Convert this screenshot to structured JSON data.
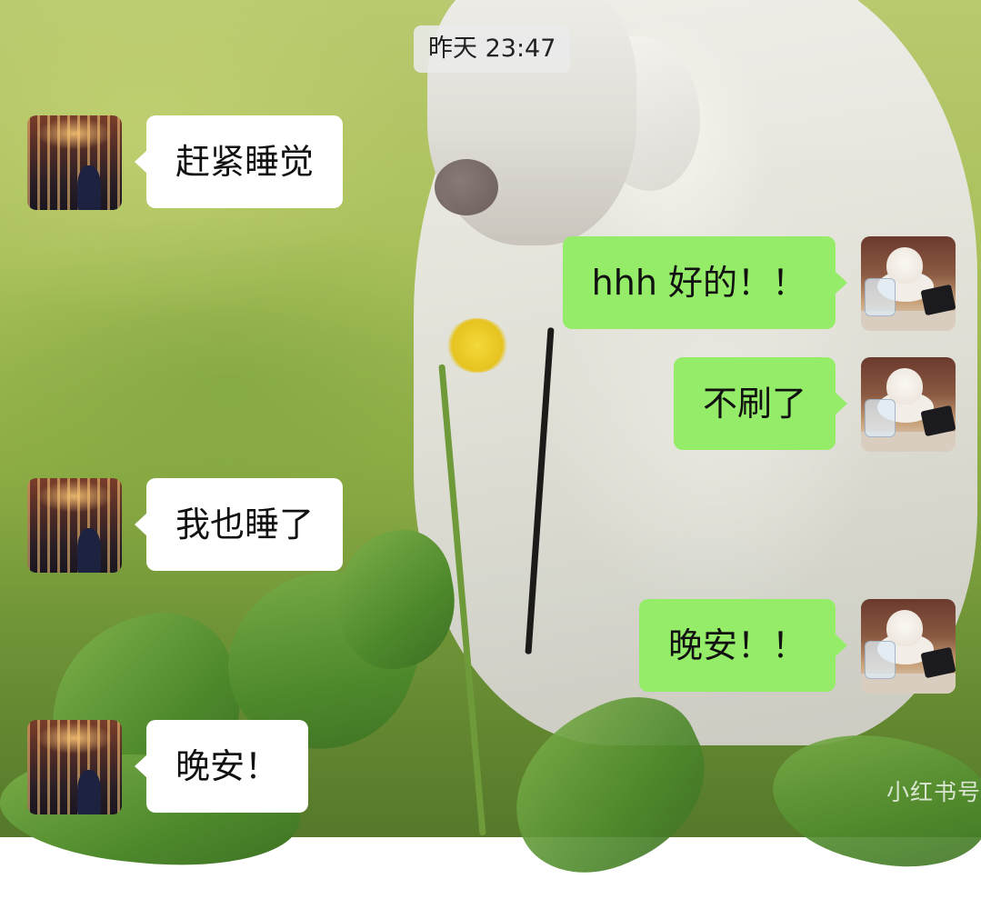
{
  "timestamp": "昨天 23:47",
  "messages": [
    {
      "side": "left",
      "text": "赶紧睡觉"
    },
    {
      "side": "right",
      "text": "hhh 好的！！"
    },
    {
      "side": "right",
      "text": "不刷了"
    },
    {
      "side": "left",
      "text": "我也睡了"
    },
    {
      "side": "right",
      "text": "晚安！！"
    },
    {
      "side": "left",
      "text": "晚安！"
    }
  ],
  "watermark": "小红书号",
  "colors": {
    "incoming_bubble": "#ffffff",
    "outgoing_bubble": "#95ec69",
    "timestamp_bg": "#ebebeb"
  },
  "avatars": {
    "left": "carousel-photo-avatar",
    "right": "white-cat-photo-avatar"
  }
}
